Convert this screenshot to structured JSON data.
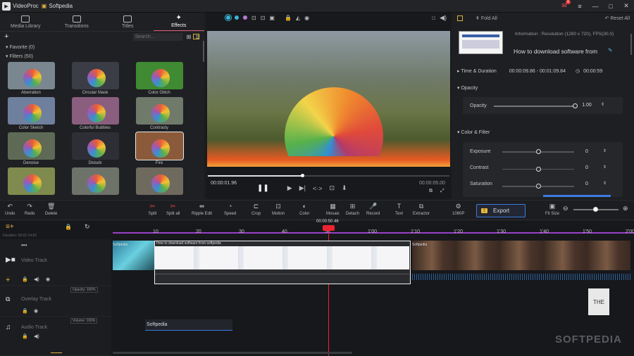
{
  "app": {
    "title": "VideoProc",
    "doc": "Softpedia",
    "notif": "6"
  },
  "left": {
    "tabs": [
      "Media Library",
      "Transitions",
      "Titles",
      "Effects"
    ],
    "search_placeholder": "Search...",
    "favorite": "Favorite (0)",
    "filters": "Filters (50)",
    "items": [
      "Aberration",
      "Circular Mask",
      "Color Glitch",
      "Color Sketch",
      "Colorful Bubbles",
      "Contrasty",
      "Denoise",
      "Disturb",
      "Fire",
      "",
      "",
      ""
    ],
    "colors": [
      "#7a8791",
      "#3a3c46",
      "#3f8a32",
      "#6f7f9e",
      "#8a5e7e",
      "#6f7a6a",
      "#5e6a55",
      "#2e2f36",
      "#8a5a3a",
      "#7f8a4e",
      "#6e736a",
      "#6e6a5e"
    ]
  },
  "preview": {
    "time_current": "00:00:01.96",
    "time_total": "00:00:05.00"
  },
  "right": {
    "fold": "Fold All",
    "reset": "Reset All",
    "info": "Information : Resolution (1280 x 720), FPS(30.0)",
    "clip_title": "How to download software from",
    "time_duration_label": "Time & Duration",
    "time_range": "00:00:09.86 - 00:01:09.84",
    "duration": "00:00:59",
    "opacity_section": "Opacity",
    "opacity_label": "Opacity",
    "opacity_value": "1.00",
    "color_section": "Color & Filter",
    "exposure_label": "Exposure",
    "exposure_value": "0",
    "contrast_label": "Contrast",
    "contrast_value": "0",
    "saturation_label": "Saturation",
    "saturation_value": "0"
  },
  "tools": [
    "Undo",
    "Redo",
    "Delete",
    "Split",
    "Split all",
    "Ripple Edit",
    "Speed",
    "Crop",
    "Motion",
    "Color",
    "Mosaic",
    "Detach",
    "Record",
    "Text",
    "Extractor"
  ],
  "quality": "1080P",
  "export_label": "Export",
  "fit_label": "Fit Size",
  "timeline": {
    "duration_label": "Duration: 00:01:14.82",
    "playhead": "00:00:50.46",
    "ruler": [
      "10",
      "20",
      "30",
      "40",
      "50",
      "1'00",
      "1'10",
      "1'20",
      "1'30",
      "1'40",
      "1'50",
      "2'00"
    ],
    "video_track": "Video Track",
    "overlay_track": "Overlay Track",
    "audio_track": "Audio Track",
    "opacity_badge": "Opacity: 100%",
    "volume_badge": "Volume: 100%",
    "clip1": "Softpedia",
    "clip2": "How to download software from softpedia",
    "clip3": "Softpedia",
    "text_clip": "THE",
    "audio_clip": "Softpedia"
  },
  "watermark": "SOFTPEDIA"
}
